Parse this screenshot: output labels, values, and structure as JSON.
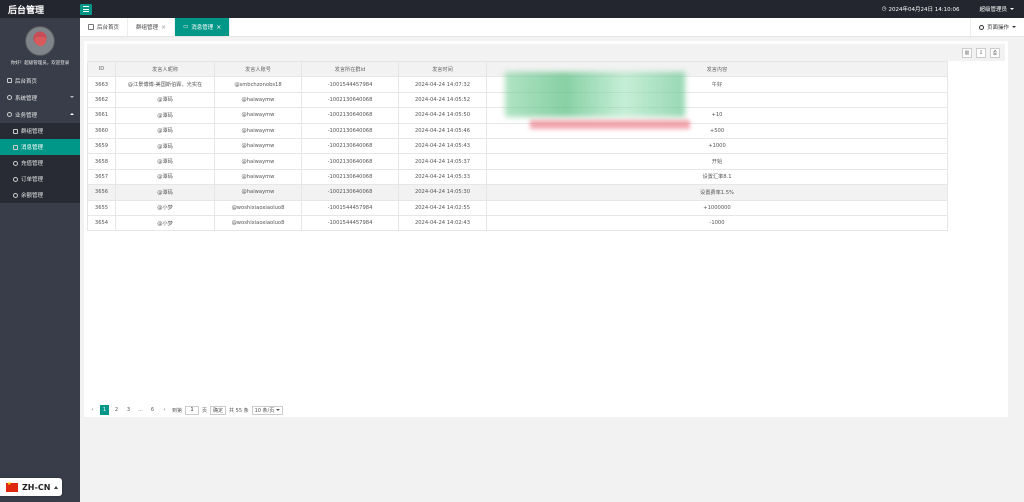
{
  "app": {
    "brand": "后台管理"
  },
  "header": {
    "datetime": "2024年04月24日 14:10:06",
    "admin_name": "超级管理员"
  },
  "sidebar": {
    "welcome": "你好！超级管理员，欢迎登录",
    "items": [
      {
        "label": "后台首页",
        "icon": "home-icon"
      },
      {
        "label": "系统管理",
        "icon": "gear-icon"
      },
      {
        "label": "业务管理",
        "icon": "gear-icon"
      }
    ],
    "sub_items": [
      {
        "label": "群组管理",
        "icon": "group-icon"
      },
      {
        "label": "消息管理",
        "icon": "message-icon",
        "active": true
      },
      {
        "label": "充值管理",
        "icon": "recharge-icon"
      },
      {
        "label": "订单管理",
        "icon": "order-icon"
      },
      {
        "label": "余额管理",
        "icon": "balance-icon"
      }
    ]
  },
  "tabs": [
    {
      "label": "后台首页"
    },
    {
      "label": "群组管理"
    },
    {
      "label": "消息管理",
      "active": true
    }
  ],
  "page_ops": "页面操作",
  "table": {
    "headers": [
      "ID",
      "发言人昵称",
      "发言人账号",
      "发言所在群id",
      "发言时间",
      "发言内容"
    ],
    "rows": [
      [
        "3663",
        "@江景傅博-美国斯伯霖、光实在",
        "@smbchzonobs18",
        "-1001544457984",
        "2024-04-24 14:07:32",
        "午好"
      ],
      [
        "3662",
        "@潭码",
        "@haiwaymw",
        "-1002130640068",
        "2024-04-24 14:05:52",
        ""
      ],
      [
        "3661",
        "@潭码",
        "@haiwaymw",
        "-1002130640068",
        "2024-04-24 14:05:50",
        "+10"
      ],
      [
        "3660",
        "@潭码",
        "@haiwaymw",
        "-1002130640068",
        "2024-04-24 14:05:46",
        "+500"
      ],
      [
        "3659",
        "@潭码",
        "@haiwaymw",
        "-1002130640068",
        "2024-04-24 14:05:43",
        "+1000"
      ],
      [
        "3658",
        "@潭码",
        "@haiwaymw",
        "-1002130640068",
        "2024-04-24 14:05:37",
        "开始"
      ],
      [
        "3657",
        "@潭码",
        "@haiwaymw",
        "-1002130640068",
        "2024-04-24 14:05:33",
        "设置汇率8.1"
      ],
      [
        "3656",
        "@潭码",
        "@haiwaymw",
        "-1002130640068",
        "2024-04-24 14:05:30",
        "设置费率1.5%"
      ],
      [
        "3655",
        "@小梦",
        "@woshixiaoxiaoluo8",
        "-1001544457984",
        "2024-04-24 14:02:55",
        "+1000000"
      ],
      [
        "3654",
        "@小梦",
        "@woshixiaoxiaoluo8",
        "-1001544457984",
        "2024-04-24 14:02:43",
        "-1000"
      ]
    ]
  },
  "pager": {
    "pages": [
      "1",
      "2",
      "3",
      "...",
      "6"
    ],
    "goto_label": "到第",
    "goto_value": "1",
    "page_unit": "页",
    "confirm": "确定",
    "total": "共 55 条",
    "per_page": "10 条/页"
  },
  "lang": {
    "label": "ZH-CN"
  },
  "colors": {
    "accent": "#009688",
    "sidebar": "#393d49",
    "header": "#23262e"
  }
}
